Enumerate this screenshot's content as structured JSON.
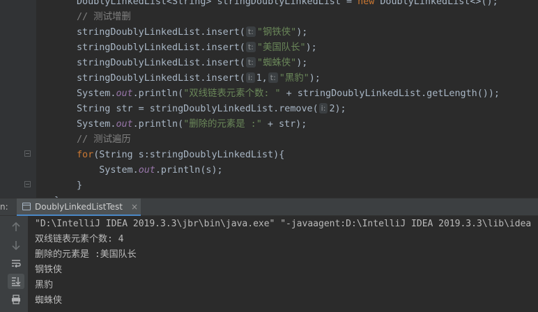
{
  "editor": {
    "code_lines": [
      {
        "segments": [
          {
            "t": "DoublyLinkedList<String> stringDoublyLinkedList = ",
            "c": ""
          },
          {
            "t": "new",
            "c": "kw"
          },
          {
            "t": " DoublyLinkedList<>();",
            "c": ""
          }
        ]
      },
      {
        "segments": [
          {
            "t": "// 测试增删",
            "c": "cm"
          }
        ]
      },
      {
        "segments": [
          {
            "t": "stringDoublyLinkedList.insert(",
            "c": ""
          },
          {
            "t": "t:",
            "c": "hint"
          },
          {
            "t": "\"钢铁侠\"",
            "c": "str"
          },
          {
            "t": ");",
            "c": ""
          }
        ]
      },
      {
        "segments": [
          {
            "t": "stringDoublyLinkedList.insert(",
            "c": ""
          },
          {
            "t": "t:",
            "c": "hint"
          },
          {
            "t": "\"美国队长\"",
            "c": "str"
          },
          {
            "t": ");",
            "c": ""
          }
        ]
      },
      {
        "segments": [
          {
            "t": "stringDoublyLinkedList.insert(",
            "c": ""
          },
          {
            "t": "t:",
            "c": "hint"
          },
          {
            "t": "\"蜘蛛侠\"",
            "c": "str"
          },
          {
            "t": ");",
            "c": ""
          }
        ]
      },
      {
        "segments": [
          {
            "t": "stringDoublyLinkedList.insert(",
            "c": ""
          },
          {
            "t": "i:",
            "c": "hint"
          },
          {
            "t": "1,",
            "c": ""
          },
          {
            "t": "t:",
            "c": "hint"
          },
          {
            "t": "\"黑豹\"",
            "c": "str"
          },
          {
            "t": ");",
            "c": ""
          }
        ]
      },
      {
        "segments": [
          {
            "t": "System.",
            "c": ""
          },
          {
            "t": "out",
            "c": "fld"
          },
          {
            "t": ".println(",
            "c": ""
          },
          {
            "t": "\"双线链表元素个数: \"",
            "c": "str"
          },
          {
            "t": " + stringDoublyLinkedList.getLength());",
            "c": ""
          }
        ]
      },
      {
        "segments": [
          {
            "t": "String str = stringDoublyLinkedList.remove(",
            "c": ""
          },
          {
            "t": "i:",
            "c": "hint"
          },
          {
            "t": "2);",
            "c": ""
          }
        ]
      },
      {
        "segments": [
          {
            "t": "System.",
            "c": ""
          },
          {
            "t": "out",
            "c": "fld"
          },
          {
            "t": ".println(",
            "c": ""
          },
          {
            "t": "\"删除的元素是 :\"",
            "c": "str"
          },
          {
            "t": " + str);",
            "c": ""
          }
        ]
      },
      {
        "segments": [
          {
            "t": "// 测试遍历",
            "c": "cm"
          }
        ]
      },
      {
        "segments": [
          {
            "t": "for",
            "c": "kw"
          },
          {
            "t": "(String s:stringDoublyLinkedList){",
            "c": ""
          }
        ]
      },
      {
        "segments": [
          {
            "t": "    System.",
            "c": ""
          },
          {
            "t": "out",
            "c": "fld"
          },
          {
            "t": ".println(s);",
            "c": ""
          }
        ]
      },
      {
        "segments": [
          {
            "t": "}",
            "c": ""
          }
        ]
      },
      {
        "segments": [
          {
            "t": "}",
            "c": ""
          }
        ]
      }
    ]
  },
  "run_panel": {
    "label": "n:",
    "tab_title": "DoublyLinkedListTest",
    "tab_close": "×",
    "toolbar_icons": [
      "up-arrow-icon",
      "down-arrow-icon",
      "soft-wrap-icon",
      "scroll-to-end-icon",
      "print-icon"
    ]
  },
  "console": {
    "lines": [
      "\"D:\\IntelliJ IDEA 2019.3.3\\jbr\\bin\\java.exe\" \"-javaagent:D:\\IntelliJ IDEA 2019.3.3\\lib\\idea",
      "双线链表元素个数: 4",
      "删除的元素是 :美国队长",
      "钢铁侠",
      "黑豹",
      "蜘蛛侠"
    ]
  }
}
